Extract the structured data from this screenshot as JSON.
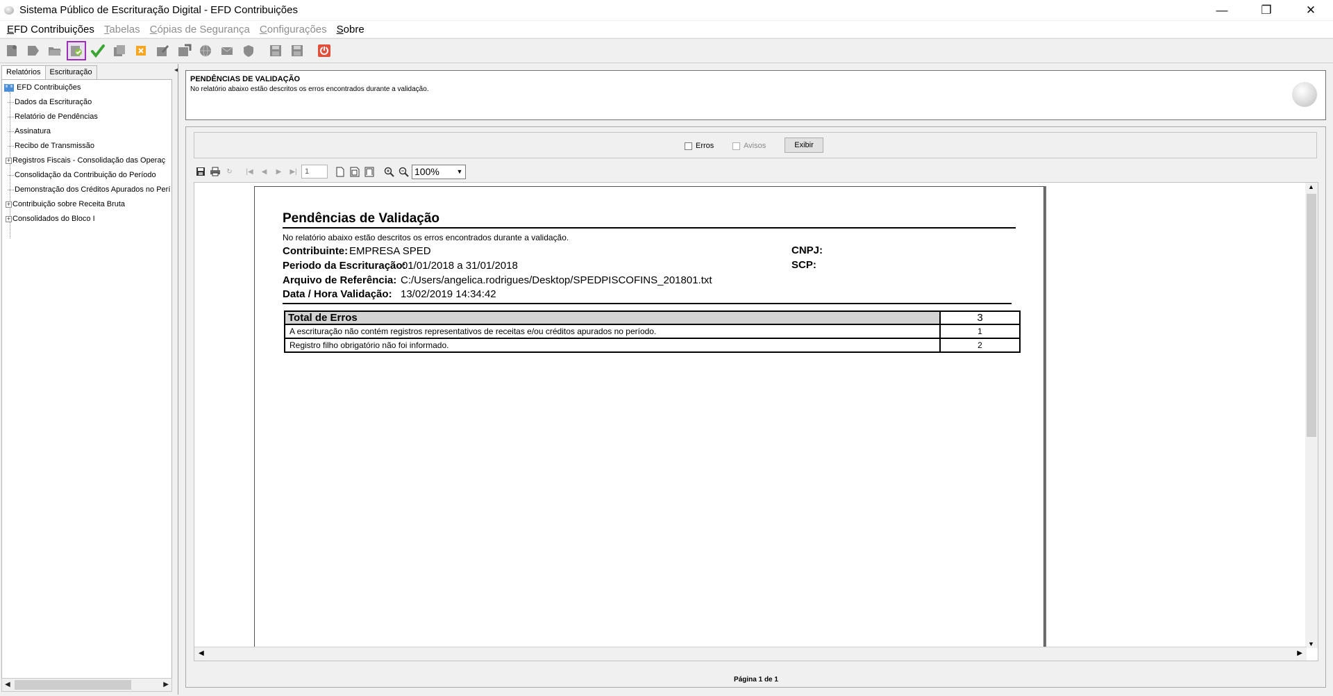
{
  "window": {
    "title": "Sistema Público de Escrituração Digital - EFD Contribuições",
    "minimize": "—",
    "restore": "❐",
    "close": "✕"
  },
  "menu": {
    "efd": {
      "mnemonic": "E",
      "rest": "FD Contribuições"
    },
    "tabelas": {
      "mnemonic": "T",
      "rest": "abelas"
    },
    "copias": {
      "mnemonic": "C",
      "rest": "ópias de Segurança"
    },
    "configuracoes": {
      "mnemonic": "C",
      "rest": "onfigurações"
    },
    "sobre": {
      "mnemonic": "S",
      "rest": "obre"
    }
  },
  "toolbar": {
    "icons": [
      "new-file-icon",
      "import-icon",
      "open-folder-icon",
      "validate-icon",
      "check-icon",
      "copy-icon",
      "delete-icon",
      "sign-icon",
      "transmit-icon",
      "globe-icon",
      "mail-icon",
      "shield-icon",
      "save-icon",
      "save-as-icon",
      "power-icon"
    ]
  },
  "left": {
    "tabs": [
      "Relatórios",
      "Escrituração"
    ],
    "tree": {
      "root": "EFD Contribuições",
      "items": [
        {
          "label": "Dados da Escrituração",
          "expandable": false
        },
        {
          "label": "Relatório de Pendências",
          "expandable": false
        },
        {
          "label": "Assinatura",
          "expandable": false
        },
        {
          "label": "Recibo de Transmissão",
          "expandable": false
        },
        {
          "label": "Registros Fiscais - Consolidação das Operaç",
          "expandable": true
        },
        {
          "label": "Consolidação da Contribuição do Período",
          "expandable": false
        },
        {
          "label": "Demonstração dos Créditos Apurados no Perí",
          "expandable": false
        },
        {
          "label": "Contribuição sobre Receita Bruta",
          "expandable": true
        },
        {
          "label": "Consolidados do Bloco I",
          "expandable": true
        }
      ]
    }
  },
  "header": {
    "title": "PENDÊNCIAS DE VALIDAÇÃO",
    "description": "No relatório abaixo estão descritos os erros encontrados durante a validação."
  },
  "filters": {
    "erros": "Erros",
    "avisos": "Avisos",
    "exibir": "Exibir"
  },
  "viewer": {
    "page_number": "1",
    "zoom": "100%",
    "status": "Página 1 de 1"
  },
  "report": {
    "title": "Pendências de Validação",
    "subtitle": "No relatório abaixo estão descritos os erros encontrados durante a validação.",
    "contribuinte_label": "Contribuinte:",
    "contribuinte_value": "EMPRESA SPED",
    "periodo_label": "Periodo da Escrituração:",
    "periodo_value": "01/01/2018 a 31/01/2018",
    "arquivo_label": "Arquivo de Referência:",
    "arquivo_value": "C:/Users/angelica.rodrigues/Desktop/SPEDPISCOFINS_201801.txt",
    "data_label": "Data / Hora Validação:",
    "data_value": "13/02/2019 14:34:42",
    "cnpj_label": "CNPJ:",
    "scp_label": "SCP:",
    "total_label": "Total de Erros",
    "total_value": "3",
    "errors": [
      {
        "description": "A escrituração não contém registros representativos de receitas e/ou créditos apurados no período.",
        "count": "1"
      },
      {
        "description": "Registro filho obrigatório não foi informado.",
        "count": "2"
      }
    ]
  }
}
